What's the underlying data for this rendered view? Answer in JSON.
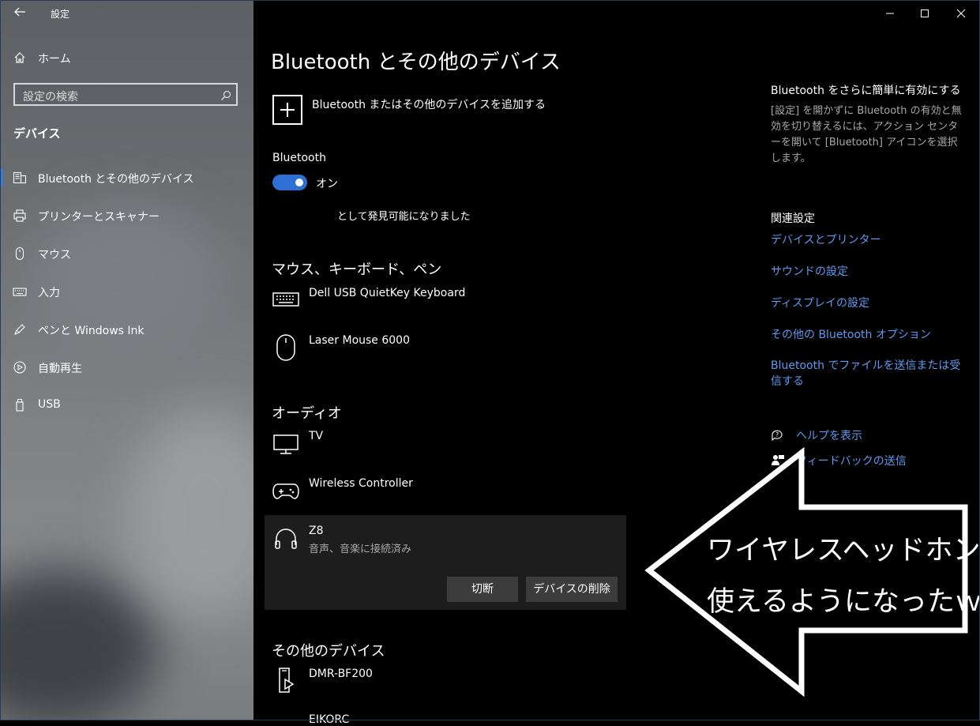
{
  "window": {
    "title": "設定",
    "back_icon": "back-arrow-icon",
    "controls": [
      "minimize-icon",
      "maximize-icon",
      "close-icon"
    ]
  },
  "sidebar": {
    "home_label": "ホーム",
    "search_placeholder": "設定の検索",
    "category": "デバイス",
    "items": [
      {
        "label": "Bluetooth とその他のデバイス",
        "icon": "bluetooth-devices-icon",
        "active": true
      },
      {
        "label": "プリンターとスキャナー",
        "icon": "printer-icon",
        "active": false
      },
      {
        "label": "マウス",
        "icon": "mouse-icon",
        "active": false
      },
      {
        "label": "入力",
        "icon": "keyboard-icon",
        "active": false
      },
      {
        "label": "ペンと Windows Ink",
        "icon": "pen-icon",
        "active": false
      },
      {
        "label": "自動再生",
        "icon": "autoplay-icon",
        "active": false
      },
      {
        "label": "USB",
        "icon": "usb-icon",
        "active": false
      }
    ]
  },
  "main": {
    "title": "Bluetooth とその他のデバイス",
    "add_device_label": "Bluetooth またはその他のデバイスを追加する",
    "bluetooth": {
      "label": "Bluetooth",
      "toggle_state": "オン",
      "discoverable_text": "として発見可能になりました"
    },
    "sections": {
      "input": {
        "heading": "マウス、キーボード、ペン",
        "devices": [
          {
            "name": "Dell USB QuietKey Keyboard",
            "icon": "keyboard-icon"
          },
          {
            "name": "Laser Mouse 6000",
            "icon": "mouse-icon"
          }
        ]
      },
      "audio": {
        "heading": "オーディオ",
        "devices": [
          {
            "name": "TV",
            "icon": "monitor-icon"
          },
          {
            "name": "Wireless Controller",
            "icon": "gamepad-icon"
          },
          {
            "name": "Z8",
            "icon": "headphones-icon",
            "status": "音声、音楽に接続済み"
          }
        ],
        "disconnect_label": "切断",
        "remove_label": "デバイスの削除"
      },
      "other": {
        "heading": "その他のデバイス",
        "devices": [
          {
            "name": "DMR-BF200",
            "icon": "media-device-icon"
          },
          {
            "name": "EIKORC",
            "icon": "device-icon"
          }
        ]
      }
    }
  },
  "right": {
    "tip_heading": "Bluetooth をさらに簡単に有効にする",
    "tip_text": "[設定] を開かずに Bluetooth の有効と無効を切り替えるには、アクション センターを開いて [Bluetooth] アイコンを選択します。",
    "related_heading": "関連設定",
    "links": [
      "デバイスとプリンター",
      "サウンドの設定",
      "ディスプレイの設定",
      "その他の Bluetooth オプション",
      "Bluetooth でファイルを送信または受信する"
    ],
    "help_label": "ヘルプを表示",
    "feedback_label": "フィードバックの送信"
  },
  "annotation": {
    "line1": "ワイヤレスヘッドホンが",
    "line2": "使えるようになったｗ"
  },
  "colors": {
    "accent": "#2e6fd6",
    "link": "#5b9bf0",
    "background": "#000000",
    "panel": "#1d1d1d",
    "button": "#3c3c3c"
  }
}
